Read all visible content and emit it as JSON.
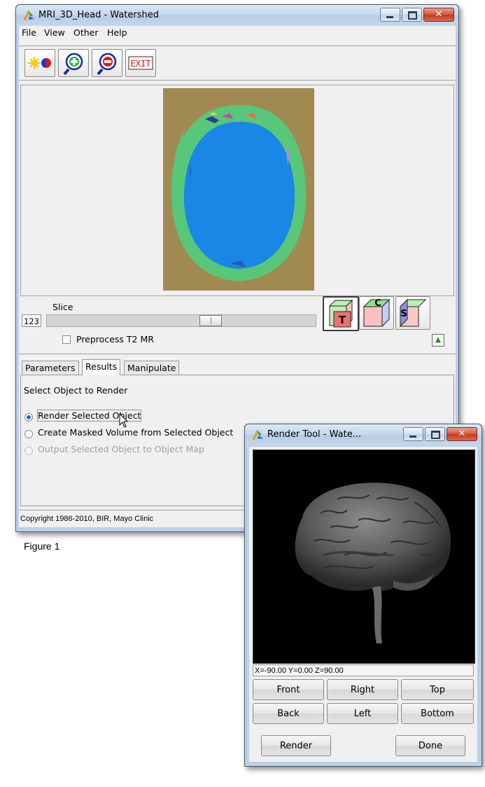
{
  "main_window": {
    "title": "MRI_3D_Head - Watershed",
    "menu": [
      "File",
      "View",
      "Other",
      "Help"
    ],
    "toolbar": {
      "buttons": [
        {
          "name": "brightness-contrast",
          "icon": "sun-contrast-icon"
        },
        {
          "name": "zoom-in",
          "icon": "zoom-in-icon"
        },
        {
          "name": "zoom-out",
          "icon": "zoom-out-icon"
        },
        {
          "name": "exit",
          "icon": "exit-sign-icon",
          "text": "EXIT"
        }
      ]
    },
    "slice": {
      "label": "Slice",
      "value": "123",
      "slider_fraction": 0.62
    },
    "orientation_buttons": [
      {
        "letter": "T",
        "active": true
      },
      {
        "letter": "C",
        "active": false
      },
      {
        "letter": "S",
        "active": false
      }
    ],
    "preprocess_label": "Preprocess T2 MR",
    "tabs": [
      "Parameters",
      "Results",
      "Manipulate"
    ],
    "active_tab": "Results",
    "results": {
      "heading": "Select Object to Render",
      "options": [
        {
          "label": "Render Selected Object",
          "checked": true,
          "enabled": true
        },
        {
          "label": "Create Masked Volume from Selected Object",
          "checked": false,
          "enabled": true
        },
        {
          "label": "Output Selected Object to Object Map",
          "checked": false,
          "enabled": false
        }
      ]
    },
    "status": "Copyright 1986-2010, BIR, Mayo Clinic"
  },
  "caption": "Figure 1",
  "render_window": {
    "title": "Render Tool - Wate...",
    "coords": "X=-90.00 Y=0.00 Z=90.00",
    "view_buttons": [
      "Front",
      "Right",
      "Top",
      "Back",
      "Left",
      "Bottom"
    ],
    "render_label": "Render",
    "done_label": "Done"
  },
  "colors": {
    "brain_blue": "#1a86e6",
    "tissue_green": "#58c77a",
    "background_brown": "#a08a52",
    "radio_blue": "#2766c8"
  }
}
